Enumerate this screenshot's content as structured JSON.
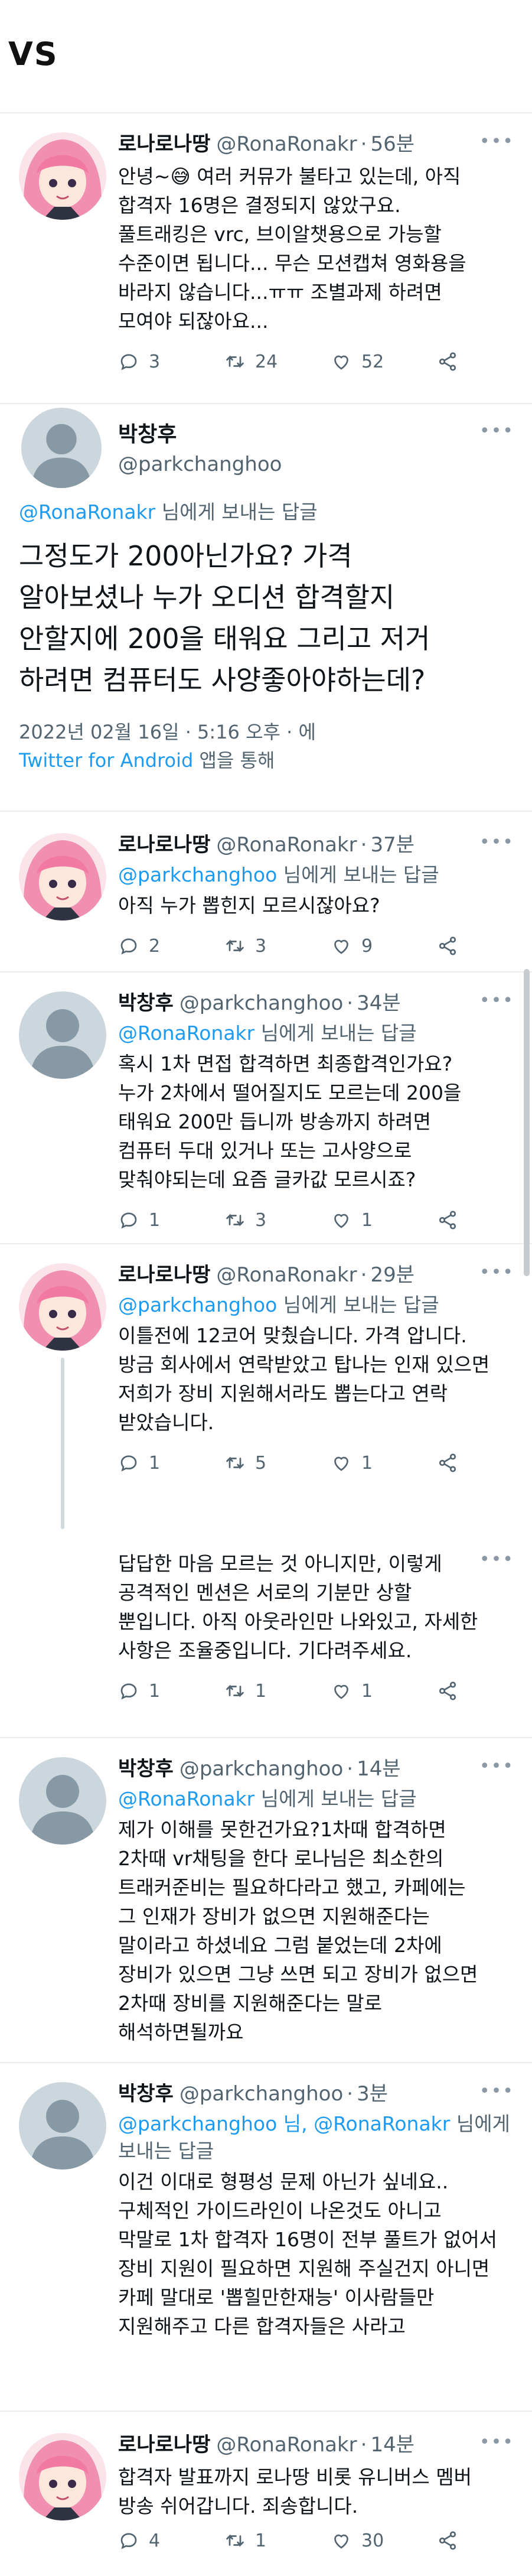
{
  "header": {
    "label": "VS"
  },
  "tweets": [
    {
      "name": "로나로나땅",
      "handle": "@RonaRonakr",
      "time": "56분",
      "reply_prefix": "",
      "reply_to": "",
      "reply_suffix": "",
      "text": "안녕~😅 여러 커뮤가 불타고 있는데, 아직\n합격자 16명은 결정되지 않았구요.\n풀트래킹은 vrc, 브이알챗용으로 가능할\n수준이면 됩니다... 무슨 모션캡쳐 영화용을\n바라지 않습니다...ㅠㅠ 조별과제 하려면\n모여야 되잖아요...",
      "replies": "3",
      "retweets": "24",
      "likes": "52"
    },
    {
      "name": "로나로나땅",
      "handle": "@RonaRonakr",
      "time": "37분",
      "reply_prefix": "",
      "reply_to": "@parkchanghoo",
      "reply_suffix": " 님에게 보내는 답글",
      "text": "아직 누가 뽑힌지 모르시잖아요?",
      "replies": "2",
      "retweets": "3",
      "likes": "9"
    },
    {
      "name": "박창후",
      "handle": "@parkchanghoo",
      "time": "34분",
      "reply_prefix": "",
      "reply_to": "@RonaRonakr",
      "reply_suffix": " 님에게 보내는 답글",
      "text": "혹시 1차 면접 합격하면 최종합격인가요?\n누가 2차에서 떨어질지도 모르는데 200을\n태워요 200만 듭니까 방송까지 하려면\n컴퓨터 두대 있거나 또는 고사양으로\n맞춰야되는데 요즘 글카값 모르시죠?",
      "replies": "1",
      "retweets": "3",
      "likes": "1"
    },
    {
      "name": "로나로나땅",
      "handle": "@RonaRonakr",
      "time": "29분",
      "reply_prefix": "",
      "reply_to": "@parkchanghoo",
      "reply_suffix": " 님에게 보내는 답글",
      "text": "이틀전에 12코어 맞췄습니다. 가격 압니다.\n방금 회사에서 연락받았고 탑나는 인재 있으면\n저희가 장비 지원해서라도 뽑는다고 연락\n받았습니다.",
      "replies": "1",
      "retweets": "5",
      "likes": "1"
    },
    {
      "name": "",
      "handle": "",
      "time": "",
      "reply_prefix": "",
      "reply_to": "",
      "reply_suffix": "",
      "text": "답답한 마음 모르는 것 아니지만, 이렇게\n공격적인 멘션은 서로의 기분만 상할\n뿐입니다. 아직 아웃라인만 나와있고, 자세한\n사항은 조율중입니다. 기다려주세요.",
      "replies": "1",
      "retweets": "1",
      "likes": "1"
    },
    {
      "name": "박창후",
      "handle": "@parkchanghoo",
      "time": "14분",
      "reply_prefix": "",
      "reply_to": "@RonaRonakr",
      "reply_suffix": " 님에게 보내는 답글",
      "text": "제가 이해를 못한건가요?1차때 합격하면\n2차때 vr채팅을 한다 로나님은 최소한의\n트래커준비는 필요하다라고 했고, 카페에는\n그 인재가 장비가 없으면 지원해준다는\n말이라고 하셨네요 그럼 붙었는데 2차에\n장비가 있으면 그냥 쓰면 되고 장비가 없으면\n2차때 장비를 지원해준다는 말로\n해석하면될까요",
      "replies": "",
      "retweets": "",
      "likes": ""
    },
    {
      "name": "박창후",
      "handle": "@parkchanghoo",
      "time": "3분",
      "reply_prefix": "",
      "reply_to": "@parkchanghoo 님, @RonaRonakr",
      "reply_suffix": " 님에게 보내는 답글",
      "text": "이건 이대로 형평성 문제 아닌가 싶네요..\n구체적인 가이드라인이 나온것도 아니고\n막말로 1차 합격자 16명이 전부 풀트가 없어서\n장비 지원이 필요하면 지원해 주실건지 아니면\n카페 말대로 '뽑힐만한재능' 이사람들만\n지원해주고 다른 합격자들은 사라고",
      "replies": "",
      "retweets": "",
      "likes": ""
    },
    {
      "name": "로나로나땅",
      "handle": "@RonaRonakr",
      "time": "14분",
      "reply_prefix": "",
      "reply_to": "",
      "reply_suffix": "",
      "text": "합격자 발표까지 로나땅 비롯 유니버스 멤버\n방송 쉬어갑니다. 죄송합니다.",
      "replies": "4",
      "retweets": "1",
      "likes": "30"
    }
  ],
  "focused": {
    "name": "박창후",
    "handle": "@parkchanghoo",
    "reply_to": "@RonaRonakr",
    "reply_suffix": " 님에게 보내는 답글",
    "text": "그정도가 200아닌가요? 가격\n알아보셨나 누가 오디션 합격할지\n안할지에 200을 태워요 그리고 저거\n하려면 컴퓨터도 사양좋아야하는데?",
    "timestamp": "2022년 02월 16일 · 5:16 오후 · 에",
    "source": "Twitter for Android",
    "source_suffix": " 앱을 통해"
  },
  "colors": {
    "text": "#0f1419",
    "muted": "#536471",
    "link": "#1d9bf0",
    "separator": "#e9edf0"
  }
}
